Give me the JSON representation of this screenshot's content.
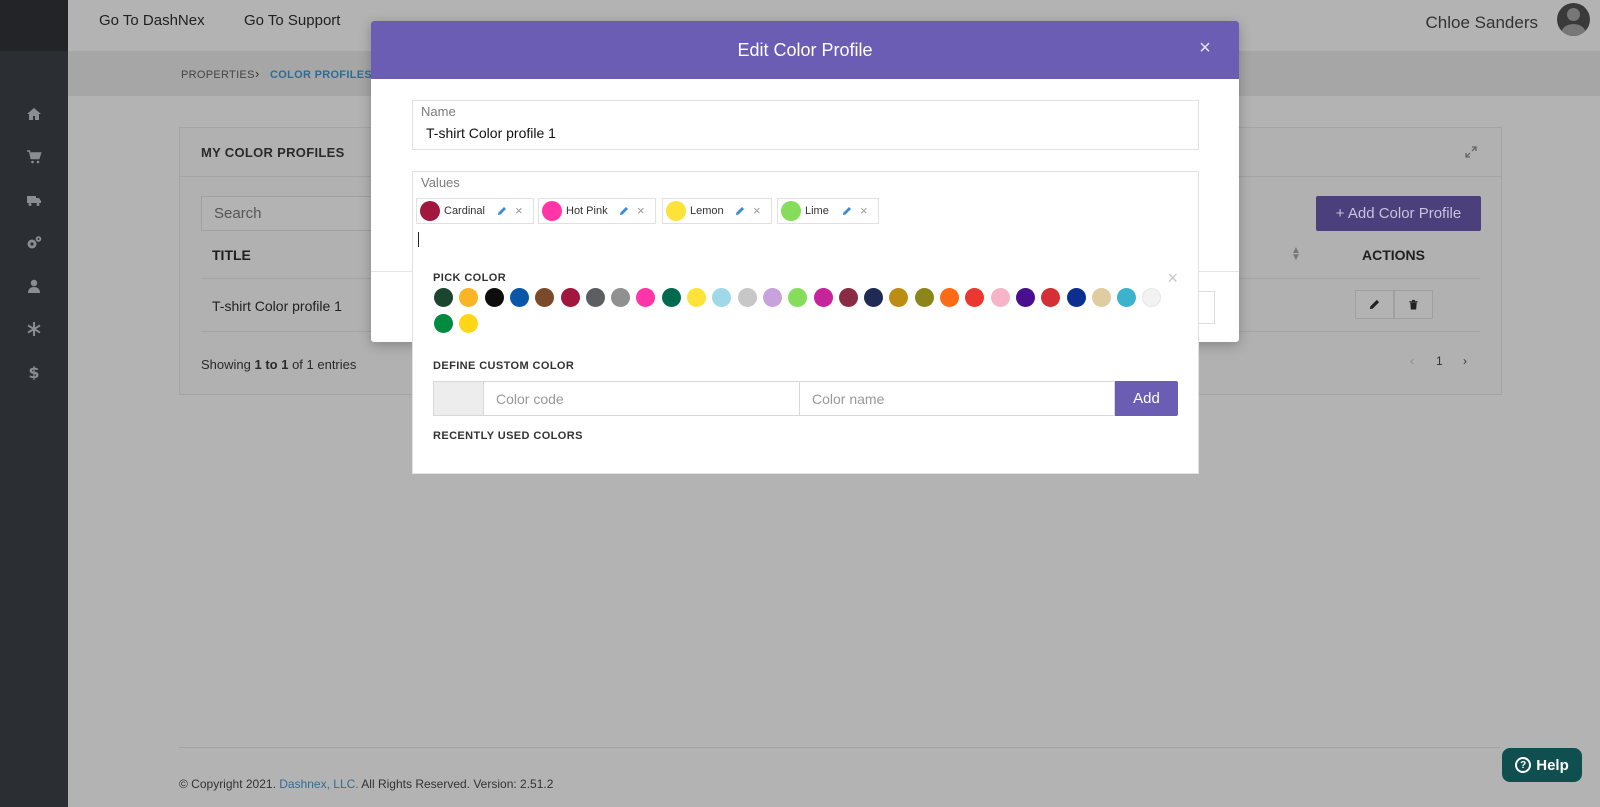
{
  "topbar": {
    "links": [
      "Go To DashNex",
      "Go To Support"
    ],
    "username": "Chloe Sanders"
  },
  "sidebar": {
    "icons": [
      "home-icon",
      "cart-icon",
      "truck-icon",
      "gears-icon",
      "user-icon",
      "asterisk-icon",
      "dollar-icon"
    ]
  },
  "breadcrumb": {
    "parent": "PROPERTIES",
    "current": "COLOR PROFILES"
  },
  "card": {
    "title": "MY COLOR PROFILES",
    "search_placeholder": "Search",
    "add_button": "+ Add Color Profile",
    "columns": {
      "title": "TITLE",
      "actions": "ACTIONS"
    },
    "rows": [
      {
        "title": "T-shirt Color profile 1"
      }
    ],
    "showing_prefix": "Showing ",
    "showing_range": "1 to 1",
    "showing_suffix": " of 1 entries",
    "pager": {
      "prev": "‹",
      "page": "1",
      "next": "›"
    }
  },
  "footer": {
    "prefix": "© Copyright 2021. ",
    "link": "Dashnex, LLC.",
    "suffix": " All Rights Reserved. Version: 2.51.2"
  },
  "help": {
    "label": "Help",
    "q": "?"
  },
  "modal": {
    "title": "Edit Color Profile",
    "close": "×",
    "name_label": "Name",
    "name_value": "T-shirt Color profile 1",
    "values_label": "Values",
    "tags": [
      {
        "name": "Cardinal",
        "color": "#a2173d"
      },
      {
        "name": "Hot Pink",
        "color": "#ff35a8"
      },
      {
        "name": "Lemon",
        "color": "#fde23a"
      },
      {
        "name": "Lime",
        "color": "#86dd5c"
      }
    ]
  },
  "picker": {
    "pick_title": "PICK COLOR",
    "close": "×",
    "colors": [
      "#1c4530",
      "#fbb424",
      "#0d0d0d",
      "#0a57a8",
      "#7a4a2a",
      "#a2173d",
      "#5c5e62",
      "#909090",
      "#ff35a8",
      "#006a4e",
      "#fde23a",
      "#9fd8e6",
      "#c7c7c7",
      "#c8a2dd",
      "#86dd5c",
      "#c5249a",
      "#8a2b46",
      "#1f2b54",
      "#bb8e13",
      "#8c861a",
      "#fc6c16",
      "#ec3730",
      "#f7b4c8",
      "#4a0f8f",
      "#d32f35",
      "#0a2f8f",
      "#dfcca1",
      "#3bb3cc",
      "#f2f2f2",
      "#028a3e",
      "#ffd717"
    ],
    "custom_title": "DEFINE CUSTOM COLOR",
    "code_placeholder": "Color code",
    "name_placeholder": "Color name",
    "add_label": "Add",
    "recent_title": "RECENTLY USED COLORS"
  }
}
